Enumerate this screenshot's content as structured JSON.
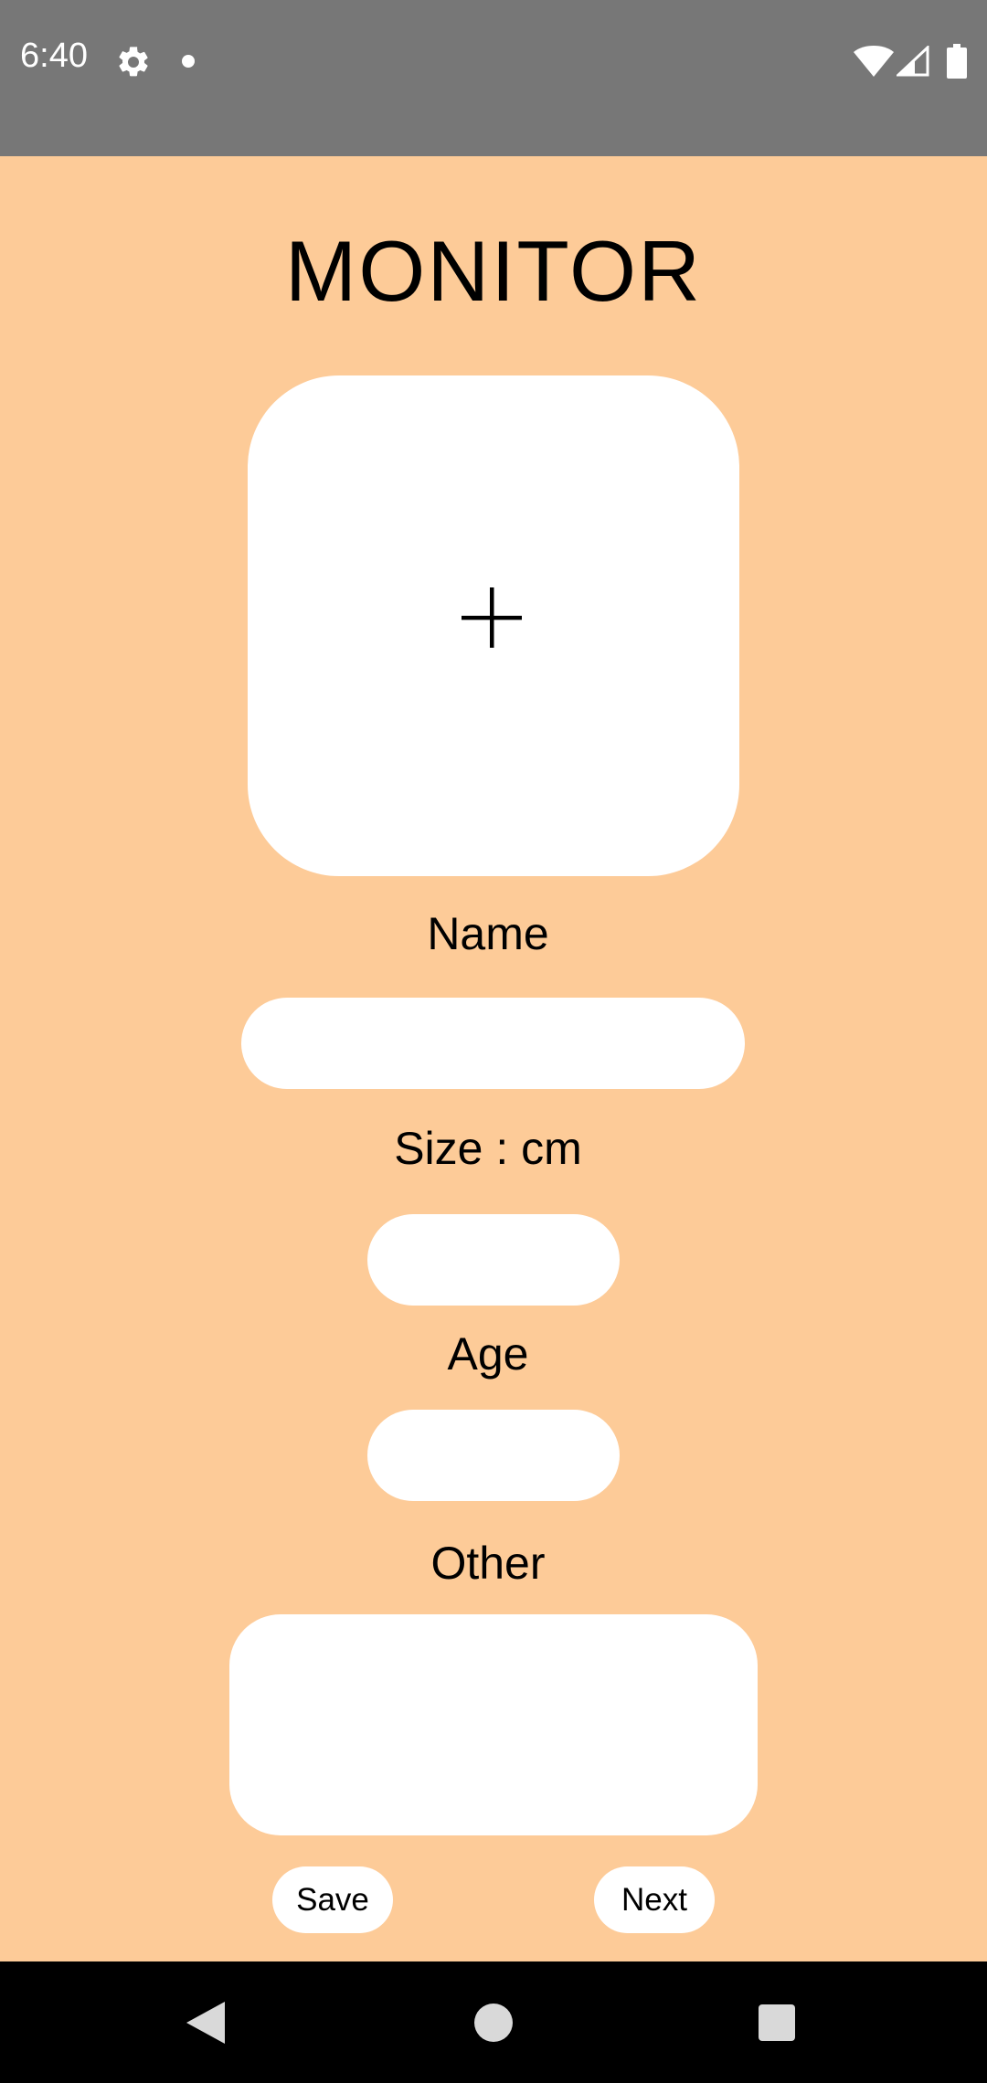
{
  "status_bar": {
    "time": "6:40",
    "icons": [
      "gear-icon",
      "notification-dot-icon",
      "wifi-icon",
      "signal-icon",
      "battery-icon"
    ]
  },
  "screen": {
    "title": "MONITOR",
    "photo_button_icon": "plus-icon",
    "name": {
      "label": "Name",
      "value": ""
    },
    "size": {
      "label": "Size : cm",
      "value": ""
    },
    "age": {
      "label": "Age",
      "value": ""
    },
    "other": {
      "label": "Other",
      "value": ""
    },
    "save_label": "Save",
    "next_label": "Next"
  },
  "nav_bar": {
    "icons": [
      "back-icon",
      "home-icon",
      "recents-icon"
    ]
  },
  "colors": {
    "background": "#fdcb98",
    "status_bar": "#777777",
    "nav_bar": "#000000",
    "field": "#ffffff"
  }
}
